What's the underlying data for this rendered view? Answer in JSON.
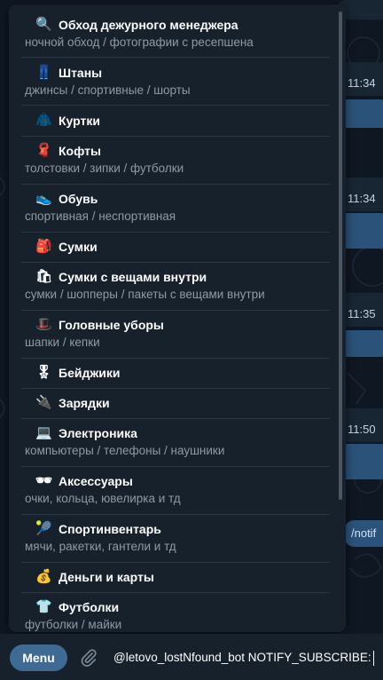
{
  "chat_background": {
    "times": [
      "11:34",
      "11:34",
      "11:35",
      "11:50"
    ],
    "command_fragment": "/notif"
  },
  "popup": {
    "items": [
      {
        "emoji": "🔍",
        "title": "Обход дежурного менеджера",
        "subtitle": "ночной обход / фотографии с ресепшена"
      },
      {
        "emoji": "👖",
        "title": "Штаны",
        "subtitle": "джинсы / спортивные / шорты"
      },
      {
        "emoji": "🧥",
        "title": "Куртки",
        "subtitle": ""
      },
      {
        "emoji": "🧣",
        "title": "Кофты",
        "subtitle": "толстовки / зипки / футболки"
      },
      {
        "emoji": "👟",
        "title": "Обувь",
        "subtitle": "спортивная / неспортивная"
      },
      {
        "emoji": "🎒",
        "title": "Сумки",
        "subtitle": ""
      },
      {
        "emoji": "🛍",
        "title": "Сумки с вещами внутри",
        "subtitle": "сумки / шопперы / пакеты с вещами внутри"
      },
      {
        "emoji": "🎩",
        "title": "Головные уборы",
        "subtitle": "шапки / кепки"
      },
      {
        "emoji": "🎖",
        "title": "Бейджики",
        "subtitle": ""
      },
      {
        "emoji": "🔌",
        "title": "Зарядки",
        "subtitle": ""
      },
      {
        "emoji": "💻",
        "title": "Электроника",
        "subtitle": "компьютеры / телефоны / наушники"
      },
      {
        "emoji": "🕶",
        "title": "Аксессуары",
        "subtitle": "очки, кольца, ювелирка и тд"
      },
      {
        "emoji": "🎾",
        "title": "Спортинвентарь",
        "subtitle": "мячи, ракетки, гантели и тд"
      },
      {
        "emoji": "💰",
        "title": "Деньги и карты",
        "subtitle": ""
      },
      {
        "emoji": "👕",
        "title": "Футболки",
        "subtitle": "футболки / майки"
      }
    ]
  },
  "bottom_bar": {
    "menu_label": "Menu",
    "input_value": "@letovo_lostNfound_bot NOTIFY_SUBSCRIBE:"
  },
  "colors": {
    "popup_bg": "#17212b",
    "menu_button": "#3e6a94",
    "subtitle_text": "#8e9aa6"
  }
}
